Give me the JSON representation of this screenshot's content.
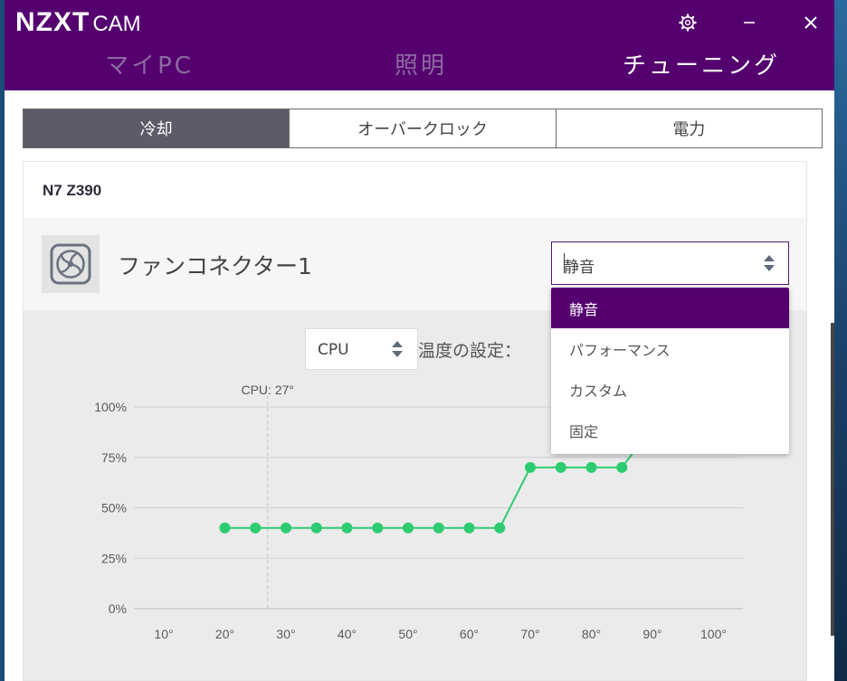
{
  "app": {
    "brand": "NZXT",
    "product": "CAM",
    "colors": {
      "accent": "#55006f",
      "curve": "#2ecc71",
      "tab_active": "#5e5a6a"
    }
  },
  "window_controls": {
    "settings_icon": "gear-icon",
    "minimize_icon": "minimize-icon",
    "close_icon": "close-icon"
  },
  "nav_tabs": [
    {
      "label": "マイPC",
      "active": false
    },
    {
      "label": "照明",
      "active": false
    },
    {
      "label": "チューニング",
      "active": true
    }
  ],
  "sub_tabs": [
    {
      "label": "冷却",
      "active": true
    },
    {
      "label": "オーバークロック",
      "active": false
    },
    {
      "label": "電力",
      "active": false
    }
  ],
  "device": {
    "name": "N7 Z390",
    "connector_label": "ファンコネクター1",
    "connector_icon": "fan-icon",
    "mode_select": {
      "value": "静音"
    },
    "mode_options": [
      {
        "label": "静音",
        "selected": true
      },
      {
        "label": "パフォーマンス",
        "selected": false
      },
      {
        "label": "カスタム",
        "selected": false
      },
      {
        "label": "固定",
        "selected": false
      }
    ],
    "temp_source": {
      "value": "CPU"
    },
    "temp_setting_label": "温度の設定："
  },
  "chart_data": {
    "type": "line",
    "title": "",
    "xlabel": "",
    "ylabel": "",
    "x_ticks": [
      "10°",
      "20°",
      "30°",
      "40°",
      "50°",
      "60°",
      "70°",
      "80°",
      "90°",
      "100°"
    ],
    "y_ticks": [
      "100%",
      "75%",
      "50%",
      "25%",
      "0%"
    ],
    "xlim": [
      10,
      100
    ],
    "ylim": [
      0,
      100
    ],
    "grid": true,
    "current_marker": {
      "label": "CPU: 27°",
      "x": 27
    },
    "series": [
      {
        "x": [
          20,
          25,
          30,
          35,
          40,
          45,
          50,
          55,
          60,
          65,
          70,
          75,
          80,
          85,
          90
        ],
        "y": [
          40,
          40,
          40,
          40,
          40,
          40,
          40,
          40,
          40,
          40,
          70,
          70,
          70,
          70,
          90
        ]
      }
    ]
  }
}
